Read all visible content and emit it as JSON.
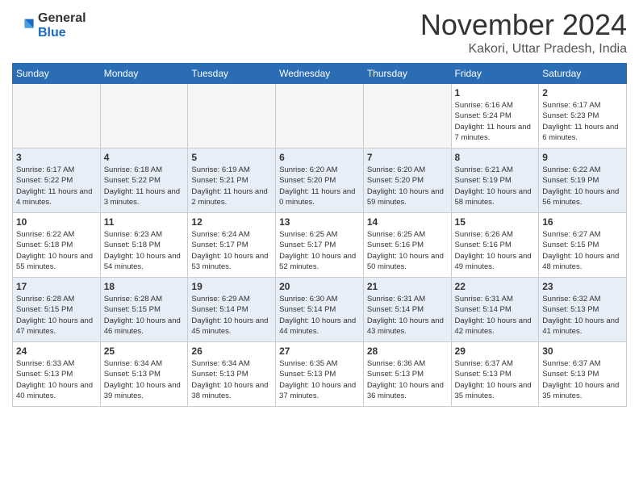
{
  "header": {
    "logo_general": "General",
    "logo_blue": "Blue",
    "month_title": "November 2024",
    "location": "Kakori, Uttar Pradesh, India"
  },
  "weekdays": [
    "Sunday",
    "Monday",
    "Tuesday",
    "Wednesday",
    "Thursday",
    "Friday",
    "Saturday"
  ],
  "weeks": [
    [
      {
        "day": "",
        "empty": true
      },
      {
        "day": "",
        "empty": true
      },
      {
        "day": "",
        "empty": true
      },
      {
        "day": "",
        "empty": true
      },
      {
        "day": "",
        "empty": true
      },
      {
        "day": "1",
        "sunrise": "6:16 AM",
        "sunset": "5:24 PM",
        "daylight": "11 hours and 7 minutes."
      },
      {
        "day": "2",
        "sunrise": "6:17 AM",
        "sunset": "5:23 PM",
        "daylight": "11 hours and 6 minutes."
      }
    ],
    [
      {
        "day": "3",
        "sunrise": "6:17 AM",
        "sunset": "5:22 PM",
        "daylight": "11 hours and 4 minutes."
      },
      {
        "day": "4",
        "sunrise": "6:18 AM",
        "sunset": "5:22 PM",
        "daylight": "11 hours and 3 minutes."
      },
      {
        "day": "5",
        "sunrise": "6:19 AM",
        "sunset": "5:21 PM",
        "daylight": "11 hours and 2 minutes."
      },
      {
        "day": "6",
        "sunrise": "6:20 AM",
        "sunset": "5:20 PM",
        "daylight": "11 hours and 0 minutes."
      },
      {
        "day": "7",
        "sunrise": "6:20 AM",
        "sunset": "5:20 PM",
        "daylight": "10 hours and 59 minutes."
      },
      {
        "day": "8",
        "sunrise": "6:21 AM",
        "sunset": "5:19 PM",
        "daylight": "10 hours and 58 minutes."
      },
      {
        "day": "9",
        "sunrise": "6:22 AM",
        "sunset": "5:19 PM",
        "daylight": "10 hours and 56 minutes."
      }
    ],
    [
      {
        "day": "10",
        "sunrise": "6:22 AM",
        "sunset": "5:18 PM",
        "daylight": "10 hours and 55 minutes."
      },
      {
        "day": "11",
        "sunrise": "6:23 AM",
        "sunset": "5:18 PM",
        "daylight": "10 hours and 54 minutes."
      },
      {
        "day": "12",
        "sunrise": "6:24 AM",
        "sunset": "5:17 PM",
        "daylight": "10 hours and 53 minutes."
      },
      {
        "day": "13",
        "sunrise": "6:25 AM",
        "sunset": "5:17 PM",
        "daylight": "10 hours and 52 minutes."
      },
      {
        "day": "14",
        "sunrise": "6:25 AM",
        "sunset": "5:16 PM",
        "daylight": "10 hours and 50 minutes."
      },
      {
        "day": "15",
        "sunrise": "6:26 AM",
        "sunset": "5:16 PM",
        "daylight": "10 hours and 49 minutes."
      },
      {
        "day": "16",
        "sunrise": "6:27 AM",
        "sunset": "5:15 PM",
        "daylight": "10 hours and 48 minutes."
      }
    ],
    [
      {
        "day": "17",
        "sunrise": "6:28 AM",
        "sunset": "5:15 PM",
        "daylight": "10 hours and 47 minutes."
      },
      {
        "day": "18",
        "sunrise": "6:28 AM",
        "sunset": "5:15 PM",
        "daylight": "10 hours and 46 minutes."
      },
      {
        "day": "19",
        "sunrise": "6:29 AM",
        "sunset": "5:14 PM",
        "daylight": "10 hours and 45 minutes."
      },
      {
        "day": "20",
        "sunrise": "6:30 AM",
        "sunset": "5:14 PM",
        "daylight": "10 hours and 44 minutes."
      },
      {
        "day": "21",
        "sunrise": "6:31 AM",
        "sunset": "5:14 PM",
        "daylight": "10 hours and 43 minutes."
      },
      {
        "day": "22",
        "sunrise": "6:31 AM",
        "sunset": "5:14 PM",
        "daylight": "10 hours and 42 minutes."
      },
      {
        "day": "23",
        "sunrise": "6:32 AM",
        "sunset": "5:13 PM",
        "daylight": "10 hours and 41 minutes."
      }
    ],
    [
      {
        "day": "24",
        "sunrise": "6:33 AM",
        "sunset": "5:13 PM",
        "daylight": "10 hours and 40 minutes."
      },
      {
        "day": "25",
        "sunrise": "6:34 AM",
        "sunset": "5:13 PM",
        "daylight": "10 hours and 39 minutes."
      },
      {
        "day": "26",
        "sunrise": "6:34 AM",
        "sunset": "5:13 PM",
        "daylight": "10 hours and 38 minutes."
      },
      {
        "day": "27",
        "sunrise": "6:35 AM",
        "sunset": "5:13 PM",
        "daylight": "10 hours and 37 minutes."
      },
      {
        "day": "28",
        "sunrise": "6:36 AM",
        "sunset": "5:13 PM",
        "daylight": "10 hours and 36 minutes."
      },
      {
        "day": "29",
        "sunrise": "6:37 AM",
        "sunset": "5:13 PM",
        "daylight": "10 hours and 35 minutes."
      },
      {
        "day": "30",
        "sunrise": "6:37 AM",
        "sunset": "5:13 PM",
        "daylight": "10 hours and 35 minutes."
      }
    ]
  ]
}
